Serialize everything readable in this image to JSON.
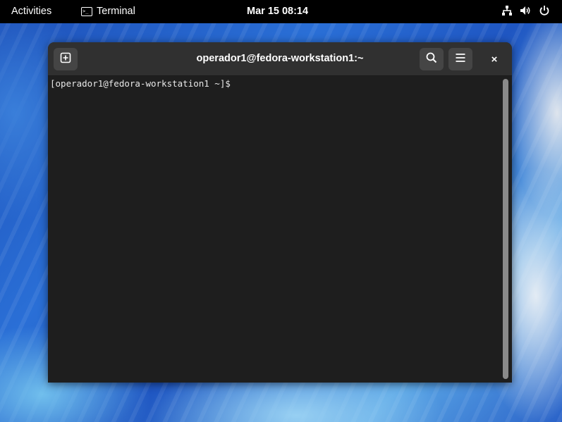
{
  "topbar": {
    "activities_label": "Activities",
    "app_name": "Terminal",
    "app_icon_glyph": ">_",
    "clock": "Mar 15  08:14",
    "tray_icons": [
      "network-icon",
      "volume-icon",
      "power-icon"
    ]
  },
  "window": {
    "title": "operador1@fedora-workstation1:~",
    "buttons": {
      "new_tab_icon": "new-tab-icon",
      "search_icon": "search-icon",
      "menu_icon": "hamburger-menu-icon",
      "close_glyph": "×"
    }
  },
  "terminal": {
    "prompt": "[operador1@fedora-workstation1 ~]$ "
  },
  "colors": {
    "topbar_bg": "#000000",
    "headerbar_bg": "#303030",
    "terminal_bg": "#1e1e1e",
    "button_bg": "#454545",
    "scrollbar": "#8a8a8a"
  }
}
